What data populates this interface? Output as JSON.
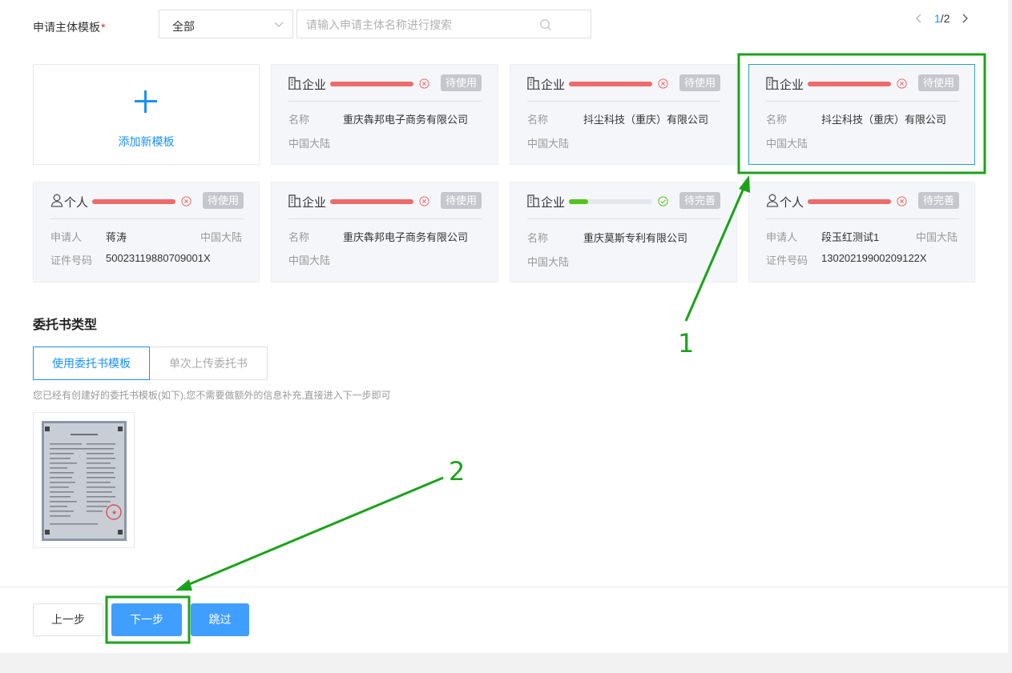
{
  "filter": {
    "label": "申请主体模板",
    "required_mark": "*",
    "select_value": "全部",
    "search_placeholder": "请输入申请主体名称进行搜索",
    "pager_current": "1",
    "pager_sep": "/",
    "pager_total": "2"
  },
  "add_card": {
    "label": "添加新模板"
  },
  "cards": [
    {
      "type": "企业",
      "badge": "待使用",
      "k1": "名称",
      "v1": "重庆犇邦电子商务有限公司",
      "k2": "中国大陆",
      "progress": 1.0,
      "state": "error"
    },
    {
      "type": "企业",
      "badge": "待使用",
      "k1": "名称",
      "v1": "抖尘科技（重庆）有限公司",
      "k2": "中国大陆",
      "progress": 1.0,
      "state": "error"
    },
    {
      "type": "企业",
      "badge": "待使用",
      "k1": "名称",
      "v1": "抖尘科技（重庆）有限公司",
      "k2": "中国大陆",
      "progress": 1.0,
      "state": "error",
      "selected": true
    },
    {
      "type": "个人",
      "badge": "待使用",
      "k1": "申请人",
      "v1": "蒋涛",
      "region": "中国大陆",
      "k2": "证件号码",
      "v2": "50023119880709001X",
      "progress": 1.0,
      "state": "error"
    },
    {
      "type": "企业",
      "badge": "待使用",
      "k1": "名称",
      "v1": "重庆犇邦电子商务有限公司",
      "k2": "中国大陆",
      "progress": 1.0,
      "state": "error"
    },
    {
      "type": "企业",
      "badge": "待完善",
      "k1": "名称",
      "v1": "重庆莫斯专利有限公司",
      "k2": "中国大陆",
      "progress": 0.23,
      "state": "ok"
    },
    {
      "type": "个人",
      "badge": "待完善",
      "k1": "申请人",
      "v1": "段玉红测试1",
      "region": "中国大陆",
      "k2": "证件号码",
      "v2": "13020219900209122X",
      "progress": 1.0,
      "state": "error"
    }
  ],
  "entrust": {
    "title": "委托书类型",
    "tab_template": "使用委托书模板",
    "tab_upload": "单次上传委托书",
    "hint": "您已经有创建好的委托书模板(如下),您不需要做额外的信息补充,直接进入下一步即可"
  },
  "footer": {
    "prev": "上一步",
    "next": "下一步",
    "skip": "跳过"
  },
  "annotations": {
    "n1": "1",
    "n2": "2",
    "color": "#1aa31a"
  },
  "colors": {
    "primary": "#1890ff",
    "button": "#409eff",
    "error": "#ef6b6b",
    "success": "#52c41a",
    "badge": "#c5c7cc"
  }
}
